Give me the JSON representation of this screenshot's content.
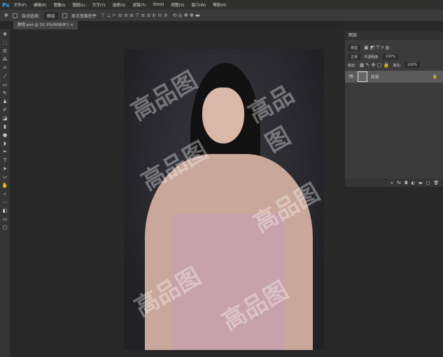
{
  "app": {
    "logo": "Ps"
  },
  "menu": [
    "文件(F)",
    "编辑(E)",
    "图像(I)",
    "图层(L)",
    "文字(Y)",
    "选择(S)",
    "滤镜(T)",
    "3D(D)",
    "视图(V)",
    "窗口(W)",
    "帮助(H)"
  ],
  "options": {
    "auto_select_label": "自动选择:",
    "auto_select_value": "图层",
    "show_transform_label": "显示变换控件"
  },
  "document": {
    "tab_title": "教程.psd @ 33.3%(RGB/8*)",
    "watermark": "高品图"
  },
  "layers_panel": {
    "title": "图层",
    "filter_kind": "类型",
    "blend_mode": "正常",
    "opacity_label": "不透明度:",
    "opacity_value": "100%",
    "lock_label": "锁定:",
    "fill_label": "填充:",
    "fill_value": "100%",
    "layers": [
      {
        "name": "背景",
        "visible": true,
        "locked": true
      }
    ]
  }
}
